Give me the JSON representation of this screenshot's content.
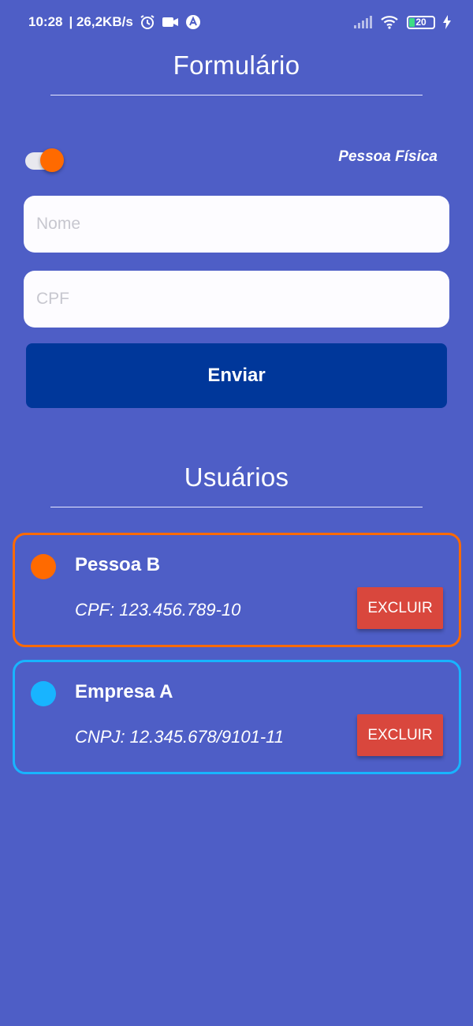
{
  "status_bar": {
    "time": "10:28",
    "speed": "| 26,2KB/s",
    "battery": "20",
    "icons": [
      "alarm-icon",
      "video-icon",
      "app-icon",
      "signal-icon",
      "wifi-icon",
      "battery-icon",
      "charging-icon"
    ]
  },
  "form": {
    "title": "Formulário",
    "toggle_label": "Pessoa Física",
    "name_placeholder": "Nome",
    "cpf_placeholder": "CPF",
    "submit_label": "Enviar"
  },
  "users": {
    "title": "Usuários",
    "items": [
      {
        "name": "Pessoa B",
        "doc": "CPF: 123.456.789-10",
        "delete_label": "EXCLUIR",
        "color": "#ff6a00"
      },
      {
        "name": "Empresa A",
        "doc": "CNPJ: 12.345.678/9101-11",
        "delete_label": "EXCLUIR",
        "color": "#18b4ff"
      }
    ]
  },
  "colors": {
    "background": "#4e5ec6",
    "button": "#00379a",
    "delete": "#d9473d",
    "toggle_knob": "#ff6a00"
  }
}
